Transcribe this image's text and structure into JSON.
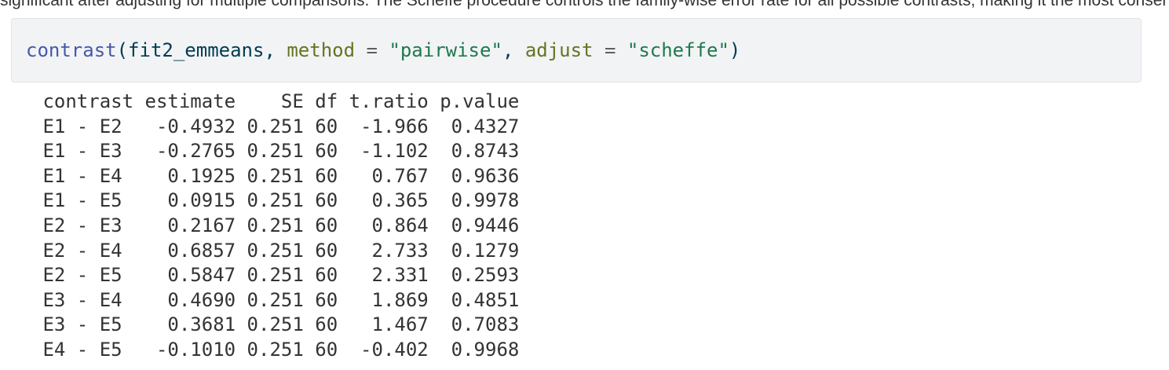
{
  "previous_line_fragment": "significant after adjusting for multiple comparisons. The Scheffe procedure controls the family-wise error rate for all possible contrasts, making it the most conservative of the common post hoc methods.",
  "code": {
    "function": "contrast",
    "open_paren": "(",
    "object": "fit2_emmeans",
    "comma1": ", ",
    "arg1_name": "method",
    "eq1": " = ",
    "arg1_value": "\"pairwise\"",
    "comma2": ", ",
    "arg2_name": "adjust",
    "eq2": " = ",
    "arg2_value": "\"scheffe\"",
    "close_paren": ")"
  },
  "output": {
    "header": [
      " contrast",
      " estimate",
      "    SE",
      " df",
      " t.ratio",
      " p.value"
    ],
    "rows": [
      [
        " E1 - E2 ",
        "  -0.4932",
        " 0.251",
        " 60",
        "  -1.966",
        "  0.4327"
      ],
      [
        " E1 - E3 ",
        "  -0.2765",
        " 0.251",
        " 60",
        "  -1.102",
        "  0.8743"
      ],
      [
        " E1 - E4 ",
        "   0.1925",
        " 0.251",
        " 60",
        "   0.767",
        "  0.9636"
      ],
      [
        " E1 - E5 ",
        "   0.0915",
        " 0.251",
        " 60",
        "   0.365",
        "  0.9978"
      ],
      [
        " E2 - E3 ",
        "   0.2167",
        " 0.251",
        " 60",
        "   0.864",
        "  0.9446"
      ],
      [
        " E2 - E4 ",
        "   0.6857",
        " 0.251",
        " 60",
        "   2.733",
        "  0.1279"
      ],
      [
        " E2 - E5 ",
        "   0.5847",
        " 0.251",
        " 60",
        "   2.331",
        "  0.2593"
      ],
      [
        " E3 - E4 ",
        "   0.4690",
        " 0.251",
        " 60",
        "   1.869",
        "  0.4851"
      ],
      [
        " E3 - E5 ",
        "   0.3681",
        " 0.251",
        " 60",
        "   1.467",
        "  0.7083"
      ],
      [
        " E4 - E5 ",
        "  -0.1010",
        " 0.251",
        " 60",
        "  -0.402",
        "  0.9968"
      ]
    ]
  }
}
